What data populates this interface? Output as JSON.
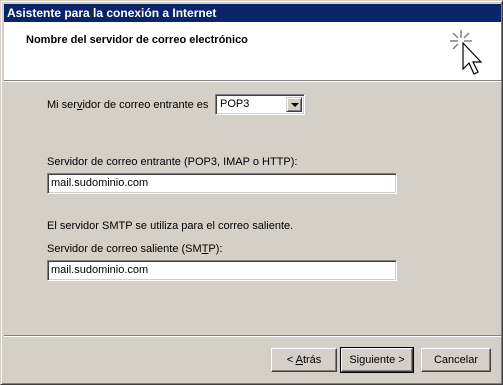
{
  "window": {
    "title": "Asistente para la conexión a Internet"
  },
  "header": {
    "title": "Nombre del servidor de correo electrónico",
    "icon": "wizard-cursor-icon"
  },
  "incoming_type": {
    "label_pre": "Mi ser",
    "label_key": "v",
    "label_post": "idor de correo entrante es",
    "selected": "POP3"
  },
  "incoming_server": {
    "label": "Servidor de correo entrante (POP3, IMAP o HTTP):",
    "value": "mail.sudominio.com"
  },
  "smtp_note": "El servidor SMTP se utiliza para el correo saliente.",
  "outgoing_server": {
    "label_pre": "Servidor de correo saliente (SM",
    "label_key": "T",
    "label_post": "P):",
    "value": "mail.sudominio.com"
  },
  "buttons": {
    "back_pre": "< ",
    "back_key": "A",
    "back_post": "trás",
    "next": "Siguiente >",
    "cancel": "Cancelar"
  }
}
